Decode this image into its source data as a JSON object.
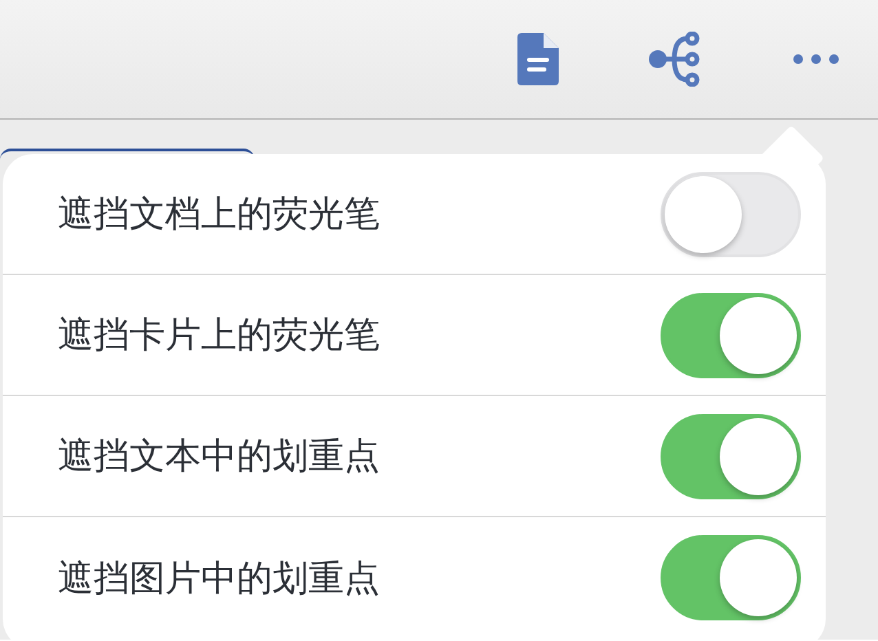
{
  "menu": {
    "items": [
      {
        "label": "遮挡文档上的荧光笔",
        "on": false
      },
      {
        "label": "遮挡卡片上的荧光笔",
        "on": true
      },
      {
        "label": "遮挡文本中的划重点",
        "on": true
      },
      {
        "label": "遮挡图片中的划重点",
        "on": true
      }
    ]
  }
}
